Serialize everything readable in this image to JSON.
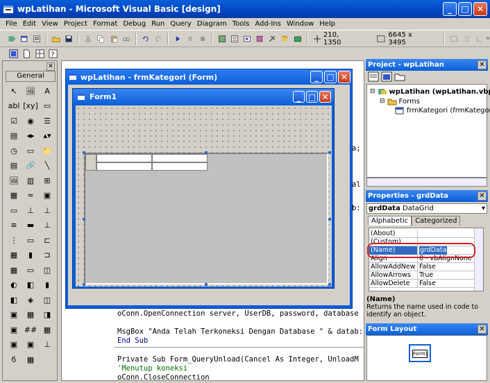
{
  "window": {
    "title": "wpLatihan - Microsoft Visual Basic [design]",
    "min": "_",
    "max": "□",
    "close": "✕"
  },
  "menu": [
    "File",
    "Edit",
    "View",
    "Project",
    "Format",
    "Debug",
    "Run",
    "Query",
    "Diagram",
    "Tools",
    "Add-Ins",
    "Window",
    "Help"
  ],
  "toolbar": {
    "position": "210, 1350",
    "size": "6645 x 3495",
    "overflow": "»"
  },
  "toolbox": {
    "tab": "General",
    "close": "✕",
    "tools": [
      "↖",
      "🖼",
      "A",
      "abl",
      "[xy]",
      "▭",
      "☑",
      "◉",
      "☰",
      "▤",
      "◂▸",
      "▴▾",
      "◷",
      "▭",
      "📁",
      "▤",
      "🔗",
      "╲",
      "🖼",
      "▥",
      "⊞",
      "▦",
      "≈",
      "▣",
      "▭",
      "⊥",
      "⊥",
      "≡",
      "▬",
      "⊥",
      "⋮",
      "▭",
      "⊏",
      "▦",
      "▮",
      "⊐",
      "▦",
      "▭",
      "◫",
      "◐",
      "◧",
      "▮",
      "◧",
      "◈",
      "◫",
      "▣",
      "▦",
      "◨",
      "▣",
      "##",
      "▦",
      "▣",
      "▣",
      "⊥",
      "ϭ",
      "▦"
    ]
  },
  "code_lines": [
    "oConn.OpenConnection server, UserDB, password, database",
    "MsgBox \"Anda Telah Terkoneksi Dengan Database \" & datab:",
    "End Sub",
    "Private Sub Form_QueryUnload(Cancel As Integer, UnloadM",
    "'Menutup koneksi",
    "oConn.CloseConnection"
  ],
  "code_fragments": [
    "a;",
    "al",
    "b:"
  ],
  "mdi_window": {
    "title": "wpLatihan - frmKategori (Form)",
    "min": "_",
    "max": "□",
    "close": "✕"
  },
  "form1": {
    "title": "Form1",
    "min": "_",
    "max": "□",
    "close": "✕"
  },
  "project": {
    "title": "Project - wpLatihan",
    "close": "✕",
    "tree": [
      "wpLatihan (wpLatihan.vbp)",
      "Forms",
      "frmKategori (frmKategori.frm"
    ]
  },
  "properties": {
    "title": "Properties - grdData",
    "close": "✕",
    "object": "grdData",
    "object_type": "DataGrid",
    "tabs": [
      "Alphabetic",
      "Categorized"
    ],
    "rows": [
      {
        "name": "(About)",
        "value": ""
      },
      {
        "name": "(Custom)",
        "value": ""
      },
      {
        "name": "(Name)",
        "value": "grdData"
      },
      {
        "name": "Align",
        "value": "0 - vbAlignNone"
      },
      {
        "name": "AllowAddNew",
        "value": "False"
      },
      {
        "name": "AllowArrows",
        "value": "True"
      },
      {
        "name": "AllowDelete",
        "value": "False"
      }
    ],
    "desc_title": "(Name)",
    "desc_text": "Returns the name used in code to identify an object."
  },
  "form_layout": {
    "title": "Form Layout",
    "close": "✕",
    "mini_label": "Form1"
  },
  "colors": {
    "titlebar": "#0a5fd8",
    "selection": "#316ac5",
    "highlight_oval": "#d02020"
  }
}
